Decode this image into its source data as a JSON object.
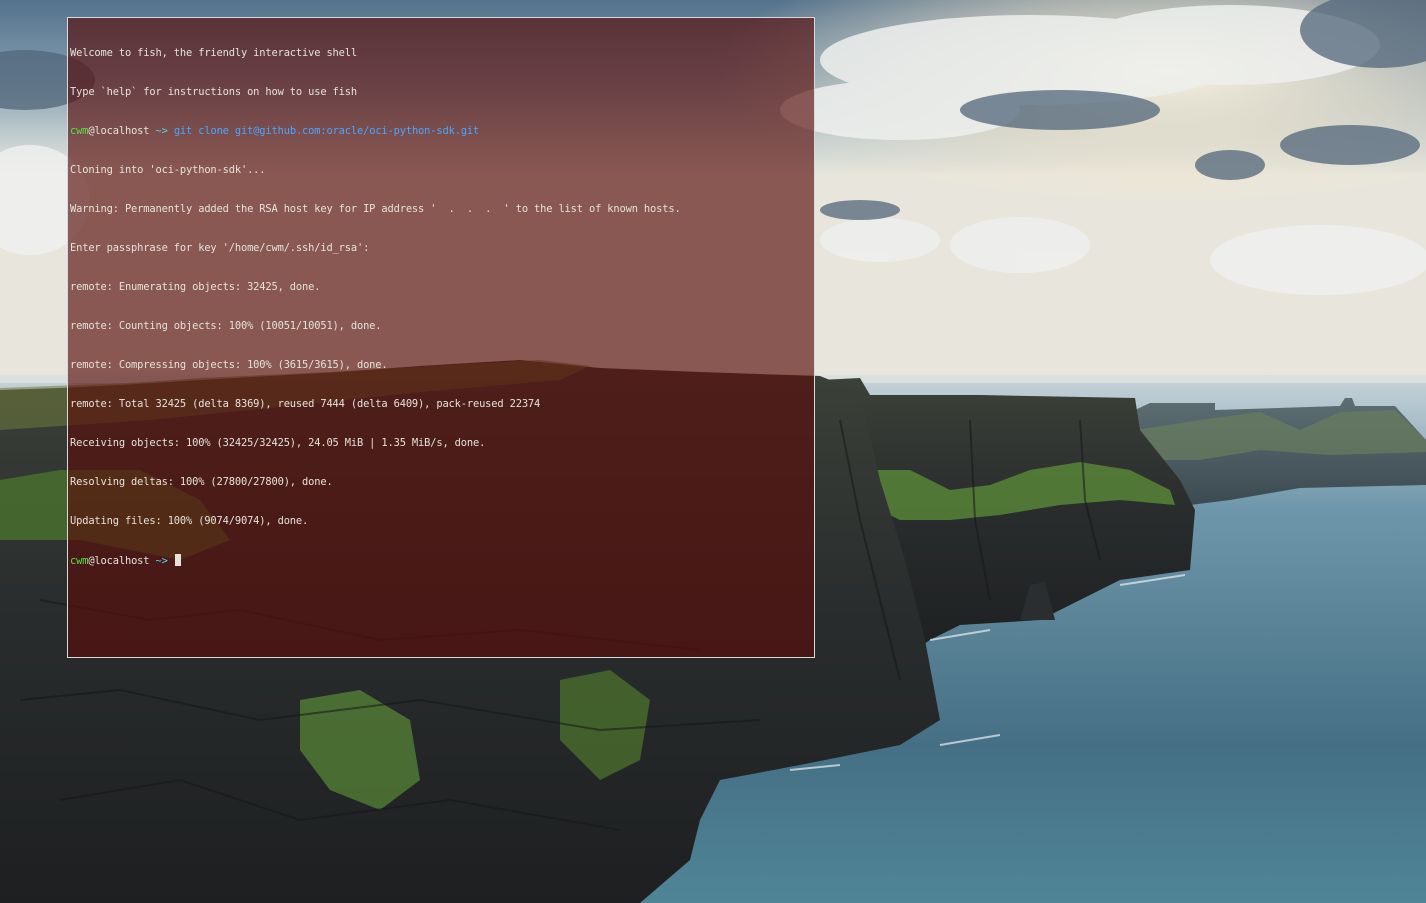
{
  "desktop": {
    "wallpaper_icon": "coastal-cliffs-wallpaper",
    "colors": {
      "sky_top": "#6f8fa8",
      "sky_bright": "#f1e4c9",
      "sea": "#5d8fa4",
      "cliff": "#25272a",
      "grass": "#4f7b2d"
    }
  },
  "terminal": {
    "background": "#580e0a",
    "colors": {
      "text": "#e6e2dc",
      "prompt_user": "#55e04e",
      "prompt_dir": "#5ad6e0",
      "command": "#4aa6ff"
    },
    "greeting": [
      "Welcome to fish, the friendly interactive shell",
      "Type `help` for instructions on how to use fish"
    ],
    "prompt1": {
      "user": "cwm",
      "host": "@localhost",
      "dir": " ~> ",
      "command": "git clone git@github.com:oracle/oci-python-sdk.git"
    },
    "output": [
      "Cloning into 'oci-python-sdk'...",
      "Warning: Permanently added the RSA host key for IP address '  .  .  .  ' to the list of known hosts.",
      "Enter passphrase for key '/home/cwm/.ssh/id_rsa':",
      "remote: Enumerating objects: 32425, done.",
      "remote: Counting objects: 100% (10051/10051), done.",
      "remote: Compressing objects: 100% (3615/3615), done.",
      "remote: Total 32425 (delta 8369), reused 7444 (delta 6409), pack-reused 22374",
      "Receiving objects: 100% (32425/32425), 24.05 MiB | 1.35 MiB/s, done.",
      "Resolving deltas: 100% (27800/27800), done.",
      "Updating files: 100% (9074/9074), done."
    ],
    "prompt2": {
      "user": "cwm",
      "host": "@localhost",
      "dir": " ~> "
    }
  }
}
